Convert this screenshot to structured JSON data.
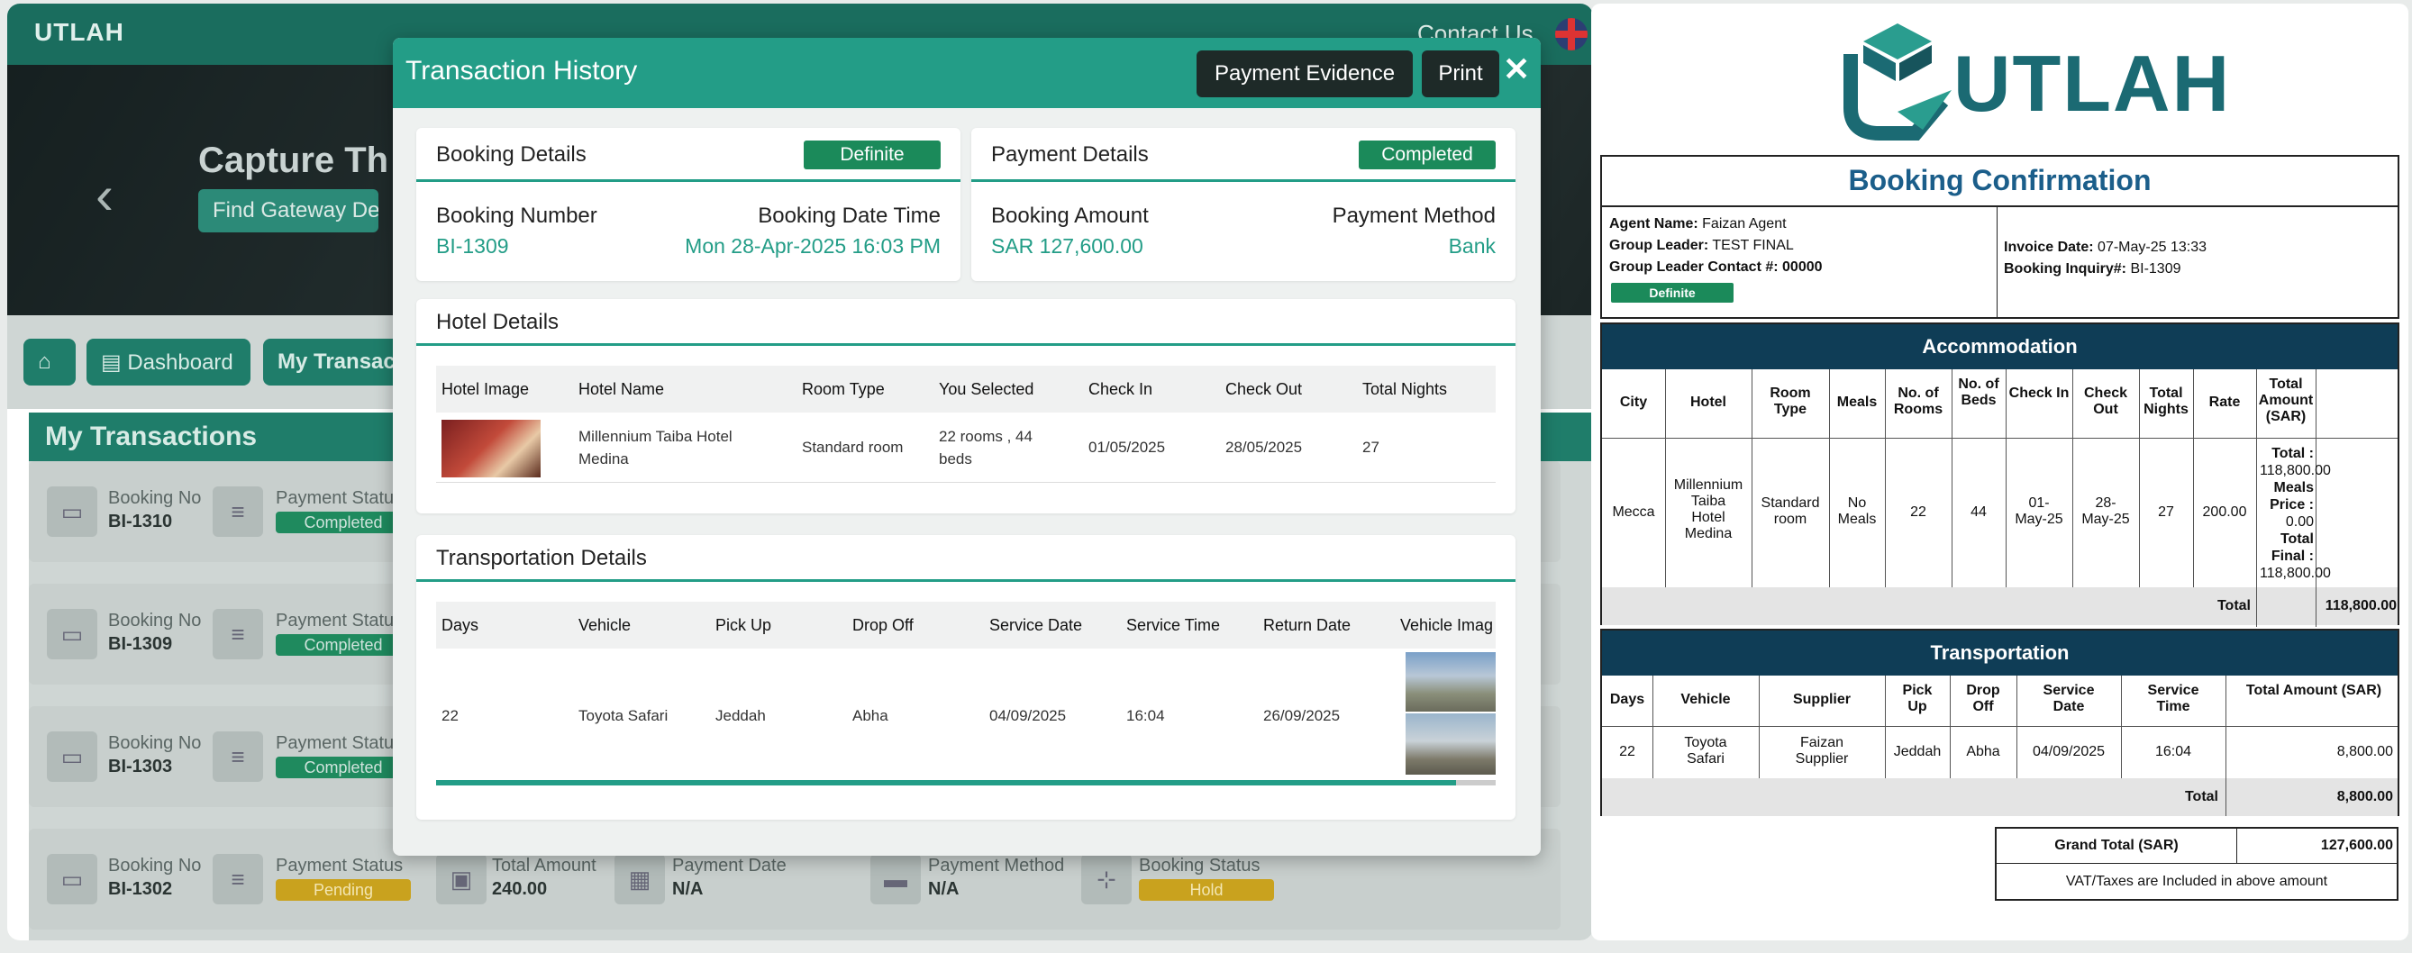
{
  "app": {
    "logo": "UTLAH",
    "contact": "Contact Us",
    "hero_title": "Capture Th",
    "hero_button": "Find Gateway Dea",
    "nav": {
      "dashboard": "Dashboard",
      "my_transactions": "My Transact"
    },
    "panel_title": "My Transactions",
    "labels": {
      "booking_no": "Booking No",
      "payment_status": "Payment Status",
      "total_amount": "Total Amount",
      "payment_date": "Payment Date",
      "payment_method": "Payment Method",
      "booking_status": "Booking Status"
    },
    "rows": [
      {
        "booking_no": "BI-1310",
        "payment_status": "Completed"
      },
      {
        "booking_no": "BI-1309",
        "payment_status": "Completed"
      },
      {
        "booking_no": "BI-1303",
        "payment_status": "Completed"
      },
      {
        "booking_no": "BI-1302",
        "payment_status": "Pending",
        "total_amount": "240.00",
        "payment_date": "N/A",
        "payment_method": "N/A",
        "booking_status": "Hold"
      }
    ]
  },
  "modal": {
    "title": "Transaction History",
    "payment_evidence": "Payment Evidence",
    "print": "Print",
    "close": "✕",
    "booking": {
      "title": "Booking Details",
      "badge": "Definite",
      "number_label": "Booking Number",
      "number": "BI-1309",
      "datetime_label": "Booking Date Time",
      "datetime": "Mon 28-Apr-2025 16:03 PM"
    },
    "payment": {
      "title": "Payment Details",
      "badge": "Completed",
      "amount_label": "Booking Amount",
      "amount": "SAR 127,600.00",
      "method_label": "Payment Method",
      "method": "Bank"
    },
    "hotel": {
      "title": "Hotel Details",
      "headers": [
        "Hotel Image",
        "Hotel Name",
        "Room Type",
        "You Selected",
        "Check In",
        "Check Out",
        "Total Nights"
      ],
      "row": {
        "name": "Millennium Taiba Hotel Medina",
        "room_type": "Standard room",
        "selected": "22 rooms , 44 beds",
        "check_in": "01/05/2025",
        "check_out": "28/05/2025",
        "nights": "27"
      }
    },
    "transport": {
      "title": "Transportation Details",
      "headers": [
        "Days",
        "Vehicle",
        "Pick Up",
        "Drop Off",
        "Service Date",
        "Service Time",
        "Return Date",
        "Vehicle Imag"
      ],
      "row": {
        "days": "22",
        "vehicle": "Toyota Safari",
        "pick_up": "Jeddah",
        "drop_off": "Abha",
        "service_date": "04/09/2025",
        "service_time": "16:04",
        "return_date": "26/09/2025"
      }
    }
  },
  "doc": {
    "logo": "UTLAH",
    "title": "Booking Confirmation",
    "agent_label": "Agent Name:",
    "agent": "Faizan Agent",
    "leader_label": "Group Leader:",
    "leader": "TEST FINAL",
    "contact_label": "Group Leader Contact #:",
    "contact": "00000",
    "badge": "Definite",
    "invoice_label": "Invoice Date:",
    "invoice": "07-May-25 13:33",
    "inquiry_label": "Booking Inquiry#:",
    "inquiry": "BI-1309",
    "accommodation": {
      "band": "Accommodation",
      "headers": [
        "City",
        "Hotel",
        "Room Type",
        "Meals",
        "No. of Rooms",
        "No. of Beds",
        "Check In",
        "Check Out",
        "Total Nights",
        "Rate",
        "Total Amount (SAR)"
      ],
      "row": {
        "city": "Mecca",
        "hotel": "Millennium Taiba Hotel Medina",
        "room": "Standard room",
        "meals": "No Meals",
        "rooms": "22",
        "beds": "44",
        "in": "01-May-25",
        "out": "28-May-25",
        "nights": "27",
        "rate": "200.00"
      },
      "amount_lines": [
        "Total :",
        "118,800.00",
        "Meals Price :",
        "0.00",
        "Total Final :",
        "118,800.00"
      ],
      "total_label": "Total",
      "total": "118,800.00"
    },
    "transportation": {
      "band": "Transportation",
      "headers": [
        "Days",
        "Vehicle",
        "Supplier",
        "Pick Up",
        "Drop Off",
        "Service Date",
        "Service Time",
        "Total Amount (SAR)"
      ],
      "row": {
        "days": "22",
        "vehicle": "Toyota Safari",
        "supplier": "Faizan Supplier",
        "pick": "Jeddah",
        "drop": "Abha",
        "date": "04/09/2025",
        "time": "16:04",
        "amount": "8,800.00"
      },
      "total_label": "Total",
      "total": "8,800.00"
    },
    "grand_label": "Grand Total (SAR)",
    "grand": "127,600.00",
    "vat_note": "VAT/Taxes are Included in above amount"
  }
}
